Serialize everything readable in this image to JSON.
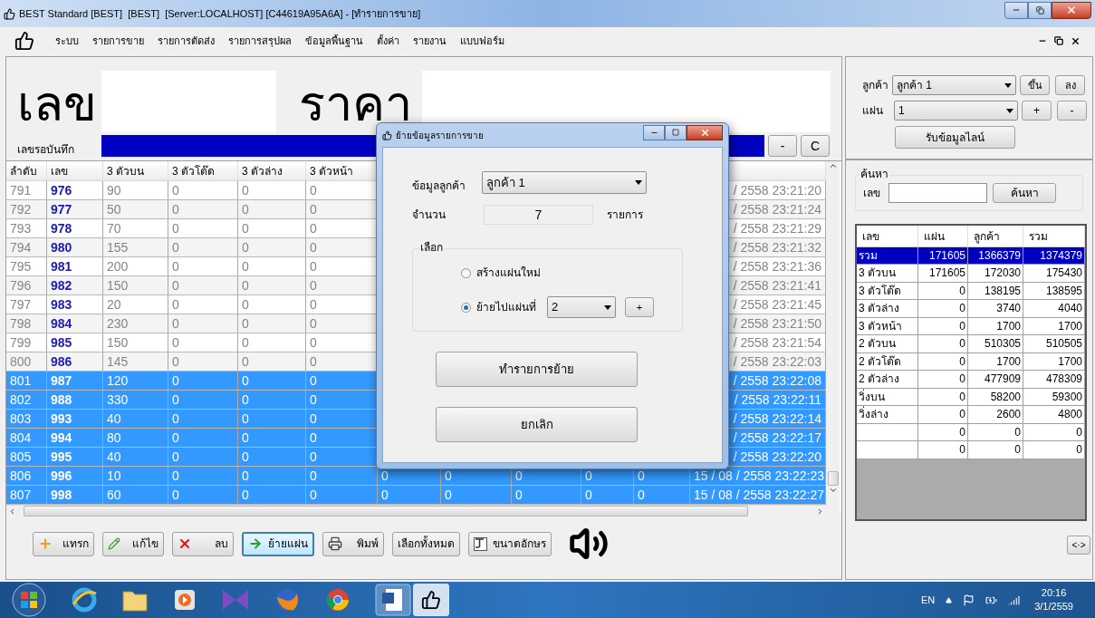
{
  "window": {
    "title": "BEST Standard [BEST]  [BEST]  [Server:LOCALHOST] [C44619A95A6A] - [ทำรายการขาย]"
  },
  "menu": [
    "ระบบ",
    "รายการขาย",
    "รายการตัดส่ง",
    "รายการสรุปผล",
    "ข้อมูลพื้นฐาน",
    "ตั้งค่า",
    "รายงาน",
    "แบบฟอร์ม"
  ],
  "entry": {
    "number_label": "เลข",
    "price_label": "ราคา",
    "pending_label": "เลขรอบันทึก",
    "buttons": [
      "-",
      "C"
    ]
  },
  "grid": {
    "columns": [
      "ลำดับ",
      "เลข",
      "3 ตัวบน",
      "3 ตัวโต๊ด",
      "3 ตัวล่าง",
      "3 ตัวหน้า"
    ],
    "rows": [
      {
        "cells": [
          "791",
          "976",
          "90",
          "0",
          "0",
          "0"
        ],
        "date": "/ 2558 23:21:20",
        "selected": false
      },
      {
        "cells": [
          "792",
          "977",
          "50",
          "0",
          "0",
          "0"
        ],
        "date": "/ 2558 23:21:24",
        "selected": false
      },
      {
        "cells": [
          "793",
          "978",
          "70",
          "0",
          "0",
          "0"
        ],
        "date": "/ 2558 23:21:29",
        "selected": false
      },
      {
        "cells": [
          "794",
          "980",
          "155",
          "0",
          "0",
          "0"
        ],
        "date": "/ 2558 23:21:32",
        "selected": false
      },
      {
        "cells": [
          "795",
          "981",
          "200",
          "0",
          "0",
          "0"
        ],
        "date": "/ 2558 23:21:36",
        "selected": false
      },
      {
        "cells": [
          "796",
          "982",
          "150",
          "0",
          "0",
          "0"
        ],
        "date": "/ 2558 23:21:41",
        "selected": false
      },
      {
        "cells": [
          "797",
          "983",
          "20",
          "0",
          "0",
          "0"
        ],
        "date": "/ 2558 23:21:45",
        "selected": false
      },
      {
        "cells": [
          "798",
          "984",
          "230",
          "0",
          "0",
          "0"
        ],
        "date": "/ 2558 23:21:50",
        "selected": false
      },
      {
        "cells": [
          "799",
          "985",
          "150",
          "0",
          "0",
          "0"
        ],
        "date": "/ 2558 23:21:54",
        "selected": false
      },
      {
        "cells": [
          "800",
          "986",
          "145",
          "0",
          "0",
          "0"
        ],
        "date": "/ 2558 23:22:03",
        "selected": false
      },
      {
        "cells": [
          "801",
          "987",
          "120",
          "0",
          "0",
          "0"
        ],
        "date": "/ 2558 23:22:08",
        "selected": true
      },
      {
        "cells": [
          "802",
          "988",
          "330",
          "0",
          "0",
          "0"
        ],
        "date": "/ 2558 23:22:11",
        "selected": true
      },
      {
        "cells": [
          "803",
          "993",
          "40",
          "0",
          "0",
          "0"
        ],
        "date": "/ 2558 23:22:14",
        "selected": true
      },
      {
        "cells": [
          "804",
          "994",
          "80",
          "0",
          "0",
          "0"
        ],
        "date": "/ 2558 23:22:17",
        "selected": true
      },
      {
        "cells": [
          "805",
          "995",
          "40",
          "0",
          "0",
          "0"
        ],
        "date": "/ 2558 23:22:20",
        "selected": true
      },
      {
        "cells": [
          "806",
          "996",
          "10",
          "0",
          "0",
          "0",
          "0",
          "0",
          "0",
          "0",
          "0"
        ],
        "date": "15 / 08 / 2558 23:22:23",
        "selected": true
      },
      {
        "cells": [
          "807",
          "998",
          "60",
          "0",
          "0",
          "0",
          "0",
          "0",
          "0",
          "0",
          "0"
        ],
        "date": "15 / 08 / 2558 23:22:27",
        "selected": true
      }
    ]
  },
  "toolbar": [
    {
      "label": "แทรก",
      "focused": false
    },
    {
      "label": "แก้ไข",
      "focused": false
    },
    {
      "label": "ลบ",
      "focused": false
    },
    {
      "label": "ย้ายแผ่น",
      "focused": true
    },
    {
      "label": "พิมพ์",
      "focused": false
    },
    {
      "label": "เลือกทั้งหมด",
      "focused": false
    },
    {
      "label": "ขนาดอักษร",
      "focused": false
    }
  ],
  "side": {
    "customer_label": "ลูกค้า",
    "customer": "ลูกค้า 1",
    "up": "ขึ้น",
    "down": "ลง",
    "sheet_label": "แผ่น",
    "sheet": "1",
    "add": "+",
    "remove": "-",
    "line_button": "รับข้อมูลไลน์",
    "search": {
      "title": "ค้นหา",
      "label": "เลข",
      "button": "ค้นหา"
    },
    "summary": {
      "columns": [
        "เลข",
        "แผ่น",
        "ลูกค้า",
        "รวม"
      ],
      "rows": [
        {
          "label": "รวม",
          "sheet": "171605",
          "customer": "1366379",
          "total": "1374379",
          "selected": true
        },
        {
          "label": "3 ตัวบน",
          "sheet": "171605",
          "customer": "172030",
          "total": "175430",
          "selected": false
        },
        {
          "label": "3 ตัวโต๊ด",
          "sheet": "0",
          "customer": "138195",
          "total": "138595",
          "selected": false
        },
        {
          "label": "3 ตัวล่าง",
          "sheet": "0",
          "customer": "3740",
          "total": "4040",
          "selected": false
        },
        {
          "label": "3 ตัวหน้า",
          "sheet": "0",
          "customer": "1700",
          "total": "1700",
          "selected": false
        },
        {
          "label": "2 ตัวบน",
          "sheet": "0",
          "customer": "510305",
          "total": "510505",
          "selected": false
        },
        {
          "label": "2 ตัวโต๊ด",
          "sheet": "0",
          "customer": "1700",
          "total": "1700",
          "selected": false
        },
        {
          "label": "2 ตัวล่าง",
          "sheet": "0",
          "customer": "477909",
          "total": "478309",
          "selected": false
        },
        {
          "label": "วิ่งบน",
          "sheet": "0",
          "customer": "58200",
          "total": "59300",
          "selected": false
        },
        {
          "label": "วิ่งล่าง",
          "sheet": "0",
          "customer": "2600",
          "total": "4800",
          "selected": false
        },
        {
          "sheet": "0",
          "customer": "0",
          "total": "0",
          "selected": false
        },
        {
          "sheet": "0",
          "customer": "0",
          "total": "0",
          "selected": false
        }
      ]
    },
    "toggle": "<·>"
  },
  "dialog": {
    "title": "ย้ายข้อมูลรายการขาย",
    "customer_label": "ข้อมูลลูกค้า",
    "customer": "ลูกค้า 1",
    "count_label": "จำนวน",
    "count": "7",
    "count_unit": "รายการ",
    "group": "เลือก",
    "options": [
      {
        "label": "สร้างแผ่นใหม่",
        "selected": false
      },
      {
        "label": "ย้ายไปแผ่นที่",
        "selected": true,
        "select_value": "2",
        "button": "+"
      }
    ],
    "buttons": [
      "ทำรายการย้าย",
      "ยกเลิก"
    ]
  },
  "taskbar": {
    "language": "EN",
    "time": "20:16",
    "date": "3/1/2559"
  }
}
